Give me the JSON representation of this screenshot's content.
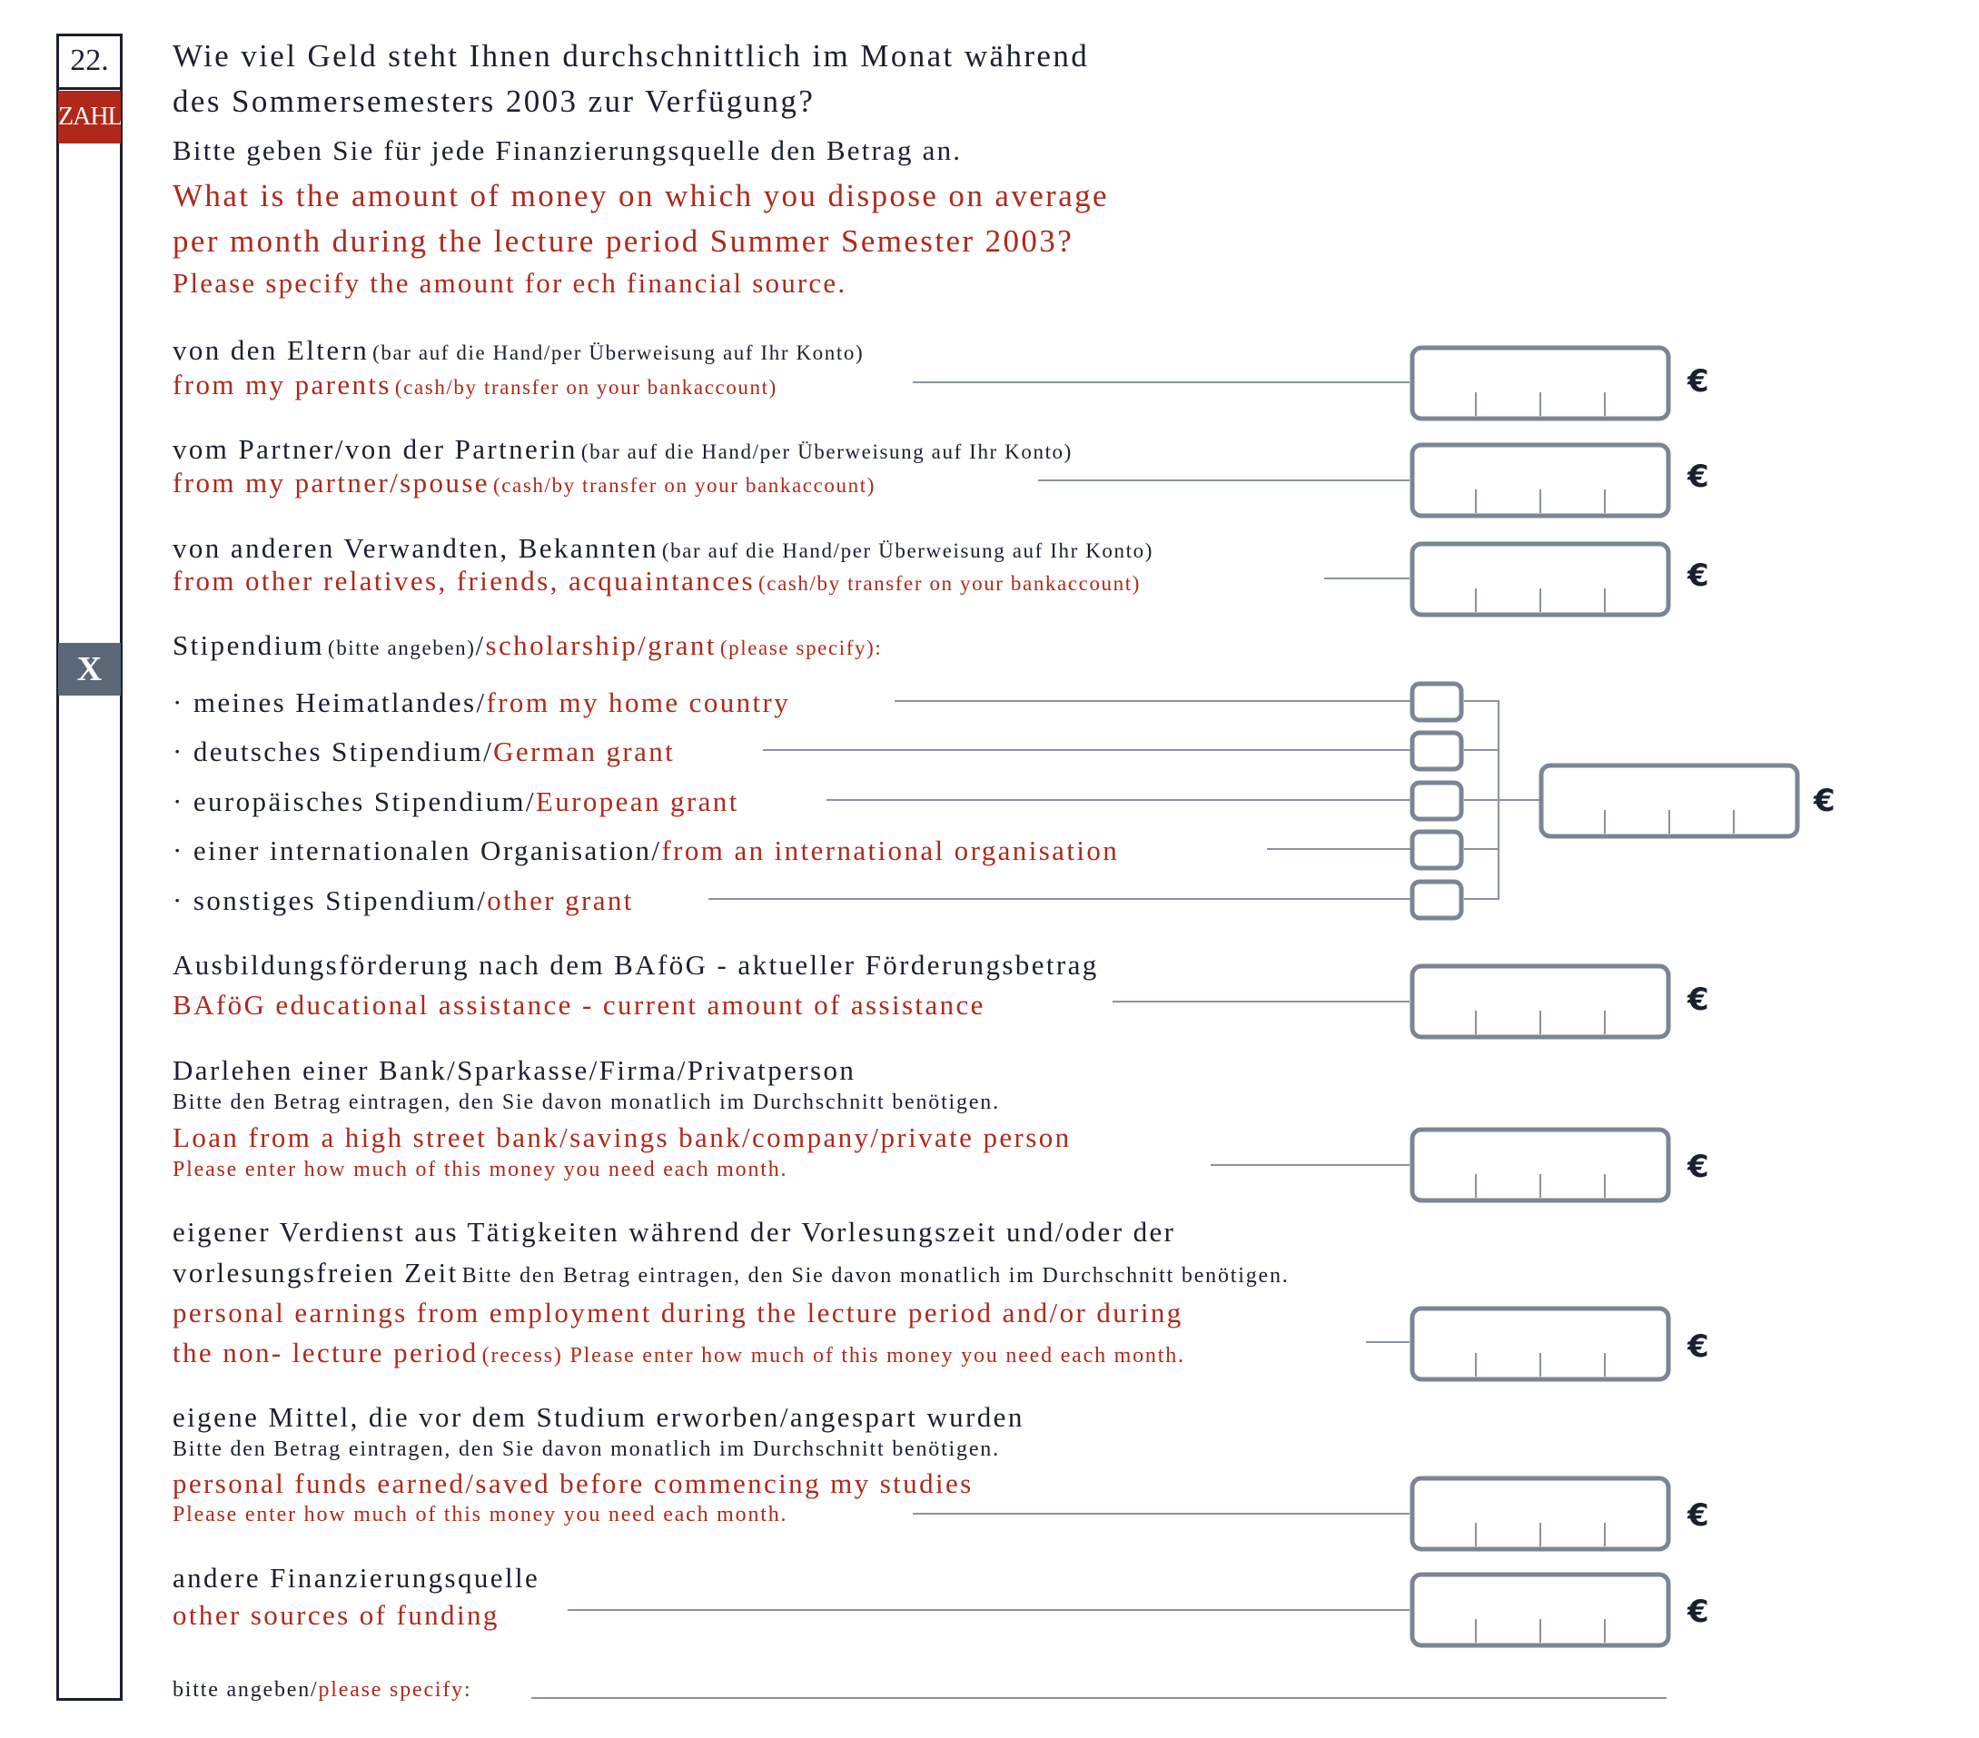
{
  "question": {
    "number": "22.",
    "zahl_badge": "ZAHL",
    "x_badge": "X",
    "de_line1": "Wie viel Geld steht Ihnen durchschnittlich im Monat während",
    "de_line2": "des Sommersemesters 2003 zur Verfügung?",
    "de_instruction": "Bitte geben Sie für jede Finanzierungsquelle den Betrag an.",
    "en_line1": "What is the amount of money on which you dispose on average",
    "en_line2": "per month during the lecture period Summer Semester 2003?",
    "en_instruction": "Please specify the amount for ech financial source."
  },
  "currency_symbol": "€",
  "rows": {
    "parents": {
      "de": "von den Eltern",
      "de_note": "(bar auf die Hand/per Überweisung auf Ihr Konto)",
      "en": "from my parents",
      "en_note": "(cash/by transfer on your  bankaccount)"
    },
    "partner": {
      "de": "vom Partner/von der Partnerin",
      "de_note": "(bar auf die Hand/per Überweisung auf Ihr Konto)",
      "en": "from my partner/spouse",
      "en_note": "(cash/by transfer on your  bankaccount)"
    },
    "relatives": {
      "de": "von anderen Verwandten, Bekannten",
      "de_note": "(bar auf die Hand/per Überweisung auf Ihr Konto)",
      "en": "from other relatives, friends, acquaintances",
      "en_note": "(cash/by transfer on your  bankaccount)"
    },
    "scholarship": {
      "de": "Stipendium",
      "de_note": "(bitte angeben)",
      "slash": "/",
      "en": "scholarship/grant",
      "en_note": "(please specify):",
      "options": [
        {
          "de": "· meines Heimatlandes/",
          "en": "from my home country"
        },
        {
          "de": "· deutsches Stipendium/",
          "en": "German grant"
        },
        {
          "de": "· europäisches Stipendium/",
          "en": "European grant"
        },
        {
          "de": "· einer internationalen Organisation/",
          "en": "from an international organisation"
        },
        {
          "de": "· sonstiges Stipendium/",
          "en": "other grant"
        }
      ]
    },
    "bafog": {
      "de": "Ausbildungsförderung nach dem BAföG -  aktueller Förderungsbetrag",
      "en": "BAföG educational assistance -  current amount of assistance"
    },
    "loan": {
      "de": "Darlehen einer Bank/Sparkasse/Firma/Privatperson",
      "de_note": "Bitte den Betrag eintragen, den Sie davon monatlich im Durchschnitt benötigen.",
      "en": "Loan from a high street bank/savings bank/company/private person",
      "en_note": "Please enter how much of this money you need each month."
    },
    "earnings": {
      "de_line1": "eigener Verdienst aus Tätigkeiten während der Vorlesungszeit und/oder der",
      "de_line2": "vorlesungsfreien Zeit",
      "de_note": "Bitte den Betrag eintragen, den Sie davon monatlich im Durchschnitt benötigen.",
      "en_line1": "personal earnings from employment during the lecture period and/or during",
      "en_line2": "the non- lecture period",
      "en_note": "(recess) Please enter how much of this money you need each month."
    },
    "own_funds": {
      "de": "eigene Mittel, die vor dem Studium erworben/angespart wurden",
      "de_note": "Bitte den Betrag eintragen, den Sie davon monatlich im Durchschnitt benötigen.",
      "en": "personal funds earned/saved before commencing my studies",
      "en_note": "Please enter how much of this money you need each month."
    },
    "other": {
      "de": "andere Finanzierungsquelle",
      "en": "other sources of funding"
    },
    "specify": {
      "de": "bitte angeben/",
      "en": "please specify:"
    }
  }
}
